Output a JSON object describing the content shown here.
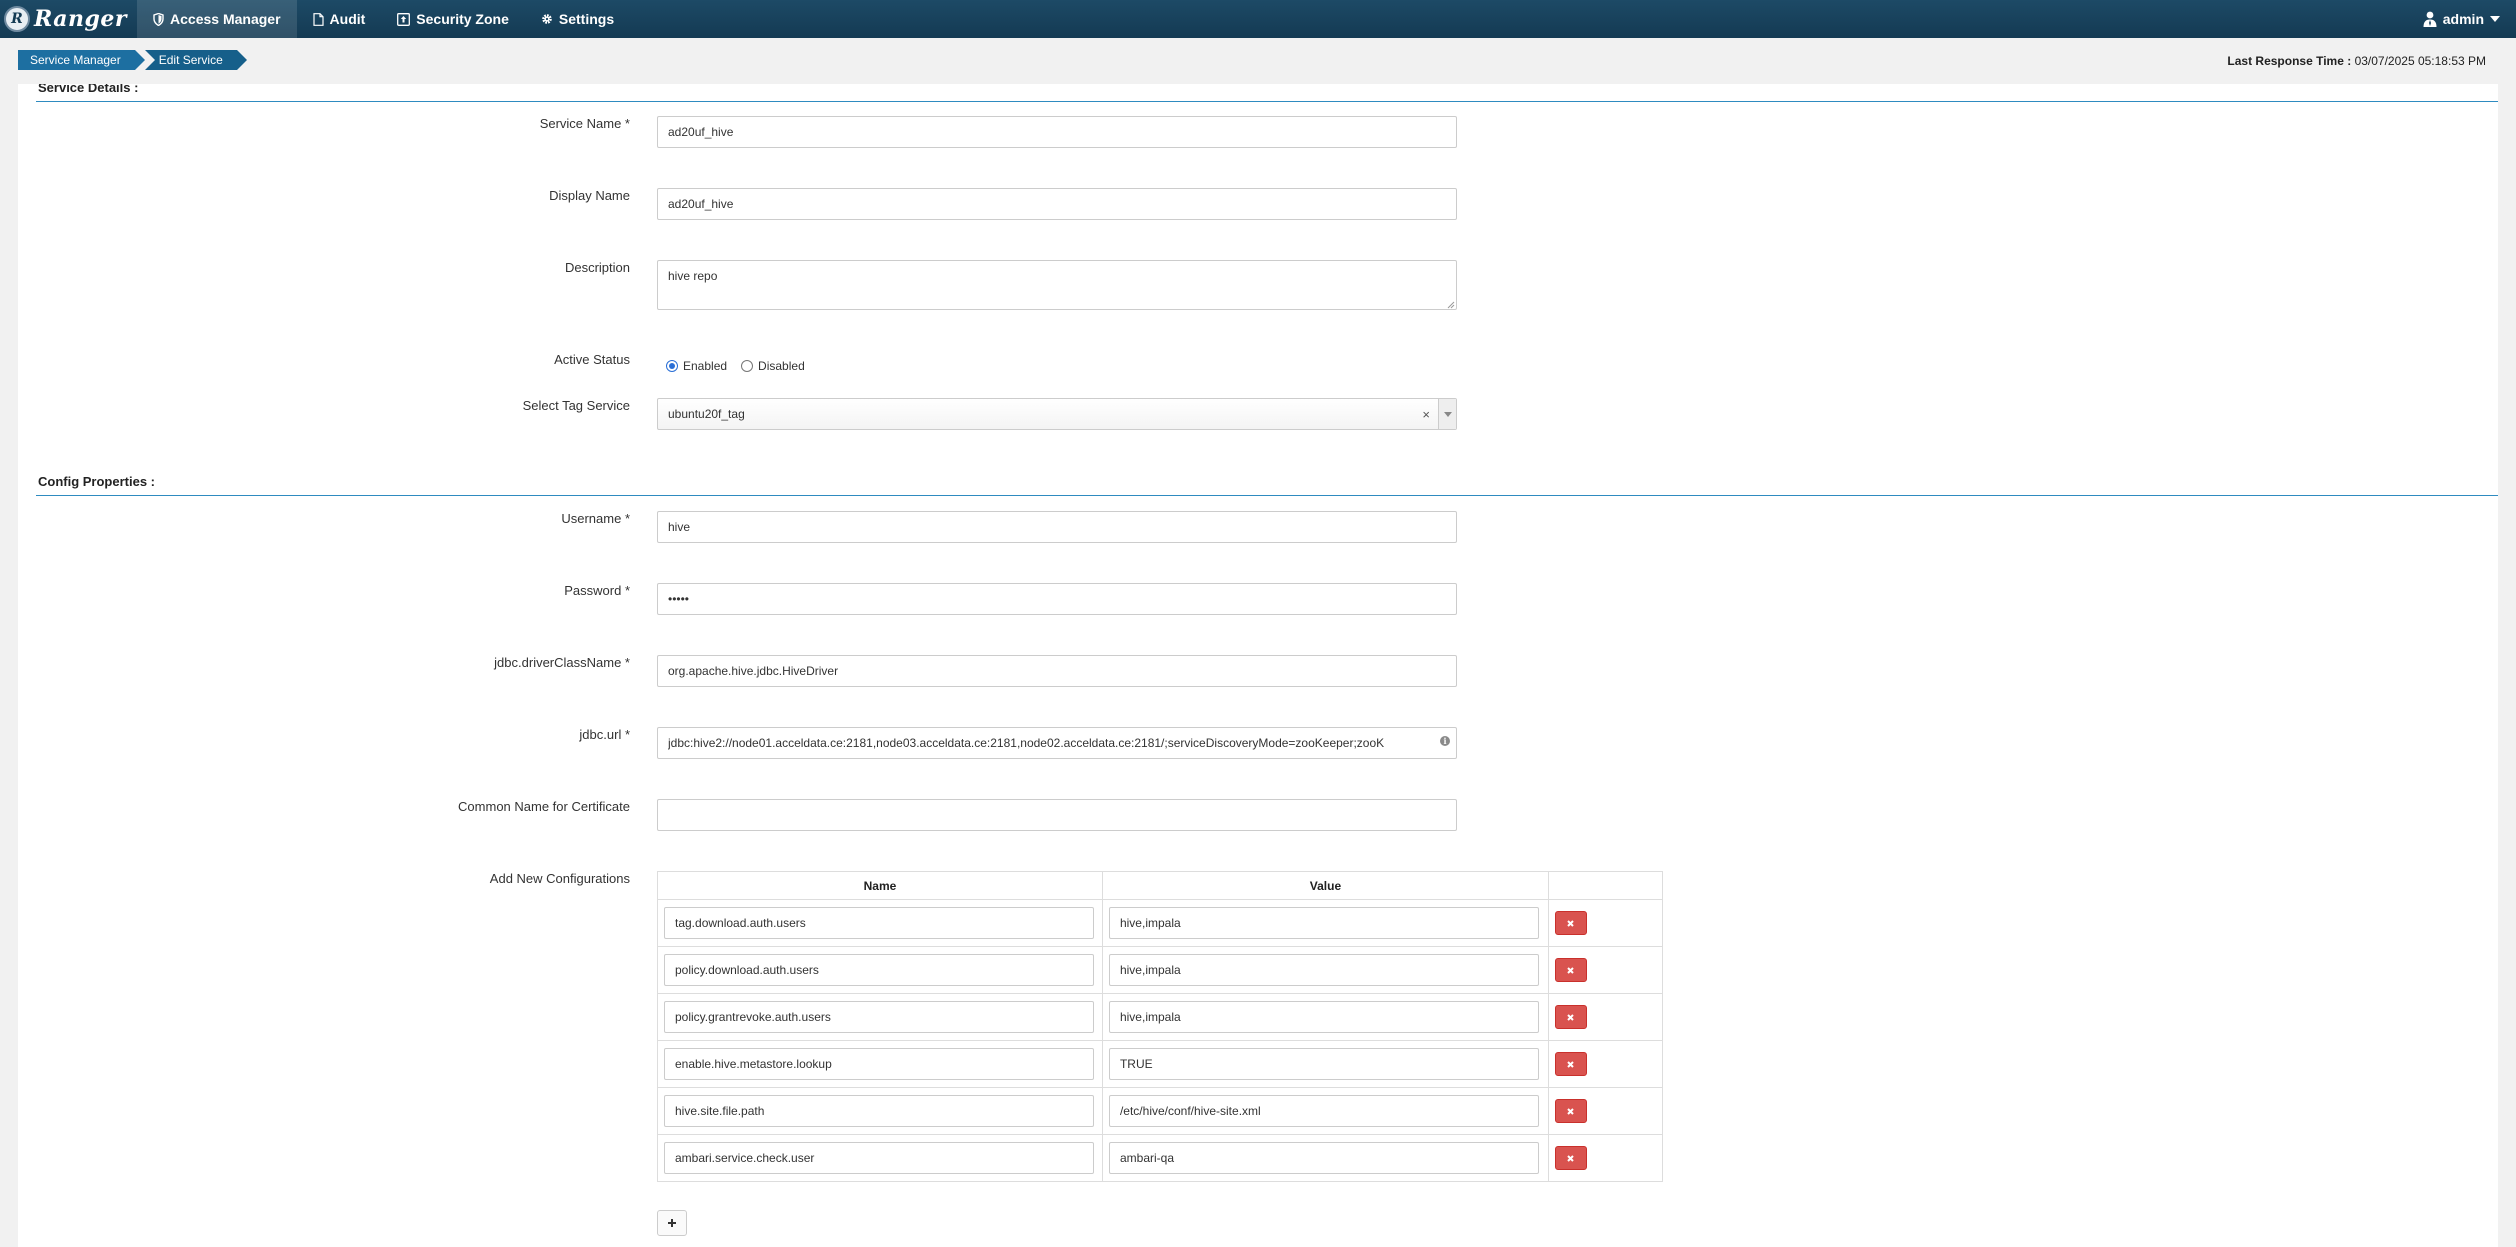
{
  "nav": {
    "brand": "Ranger",
    "brand_badge": "R",
    "items": [
      {
        "label": "Access Manager"
      },
      {
        "label": "Audit"
      },
      {
        "label": "Security Zone"
      },
      {
        "label": "Settings"
      }
    ],
    "user": "admin"
  },
  "breadcrumb": [
    "Service Manager",
    "Edit Service"
  ],
  "last_response": {
    "label": "Last Response Time :",
    "value": "03/07/2025 05:18:53 PM"
  },
  "service_details": {
    "title": "Service Details :",
    "service_name": {
      "label": "Service Name *",
      "value": "ad20uf_hive"
    },
    "display_name": {
      "label": "Display Name",
      "value": "ad20uf_hive"
    },
    "description": {
      "label": "Description",
      "value": "hive repo"
    },
    "active_status": {
      "label": "Active Status",
      "options": [
        "Enabled",
        "Disabled"
      ],
      "selected": "Enabled"
    },
    "tag_service": {
      "label": "Select Tag Service",
      "value": "ubuntu20f_tag"
    }
  },
  "config": {
    "title": "Config Properties :",
    "username": {
      "label": "Username *",
      "value": "hive"
    },
    "password": {
      "label": "Password *",
      "value": "•••••"
    },
    "driver": {
      "label": "jdbc.driverClassName *",
      "value": "org.apache.hive.jdbc.HiveDriver"
    },
    "jdbc_url": {
      "label": "jdbc.url *",
      "value": "jdbc:hive2://node01.acceldata.ce:2181,node03.acceldata.ce:2181,node02.acceldata.ce:2181/;serviceDiscoveryMode=zooKeeper;zooK"
    },
    "common_name": {
      "label": "Common Name for Certificate",
      "value": ""
    },
    "new_configs": {
      "label": "Add New Configurations",
      "headers": {
        "name": "Name",
        "value": "Value"
      },
      "rows": [
        {
          "name": "tag.download.auth.users",
          "value": "hive,impala"
        },
        {
          "name": "policy.download.auth.users",
          "value": "hive,impala"
        },
        {
          "name": "policy.grantrevoke.auth.users",
          "value": "hive,impala"
        },
        {
          "name": "enable.hive.metastore.lookup",
          "value": "TRUE"
        },
        {
          "name": "hive.site.file.path",
          "value": "/etc/hive/conf/hive-site.xml"
        },
        {
          "name": "ambari.service.check.user",
          "value": "ambari-qa"
        }
      ]
    }
  },
  "colors": {
    "nav": "#143a53",
    "accent": "#2e8bc0",
    "delete": "#d9534f",
    "breadcrumb": "#1d6fa1"
  }
}
